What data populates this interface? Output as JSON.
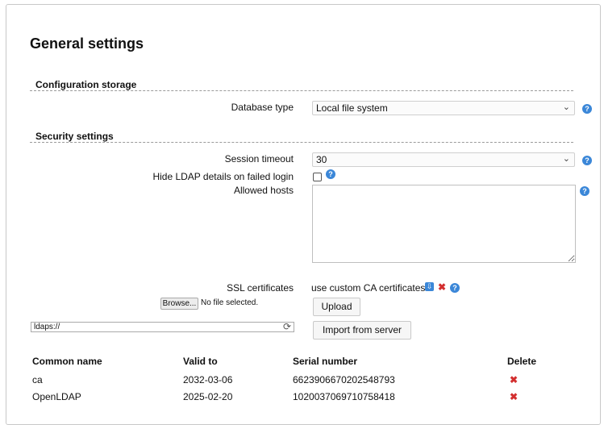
{
  "page": {
    "title": "General settings"
  },
  "config": {
    "section_title": "Configuration storage",
    "database_type_label": "Database type",
    "database_type_value": "Local file system"
  },
  "security": {
    "section_title": "Security settings",
    "session_timeout_label": "Session timeout",
    "session_timeout_value": "30",
    "hide_ldap_label": "Hide LDAP details on failed login",
    "hide_ldap_checked": false,
    "allowed_hosts_label": "Allowed hosts",
    "allowed_hosts_value": "",
    "ssl_label": "SSL certificates",
    "ssl_custom_ca_text": "use custom CA certificates",
    "browse_label": "Browse...",
    "no_file_text": "No file selected.",
    "upload_label": "Upload",
    "server_url_value": "ldaps://",
    "import_label": "Import from server"
  },
  "certificates": {
    "columns": [
      "Common name",
      "Valid to",
      "Serial number",
      "Delete"
    ],
    "rows": [
      {
        "common_name": "ca",
        "valid_to": "2032-03-06",
        "serial": "6623906670202548793"
      },
      {
        "common_name": "OpenLDAP",
        "valid_to": "2025-02-20",
        "serial": "1020037069710758418"
      }
    ]
  },
  "icons": {
    "help": "question-icon",
    "delete": "delete-x-icon",
    "download": "download-icon",
    "chevron": "chevron-down-icon",
    "refresh": "refresh-icon"
  },
  "colors": {
    "accent": "#3b87d8",
    "danger": "#d32f2f"
  }
}
